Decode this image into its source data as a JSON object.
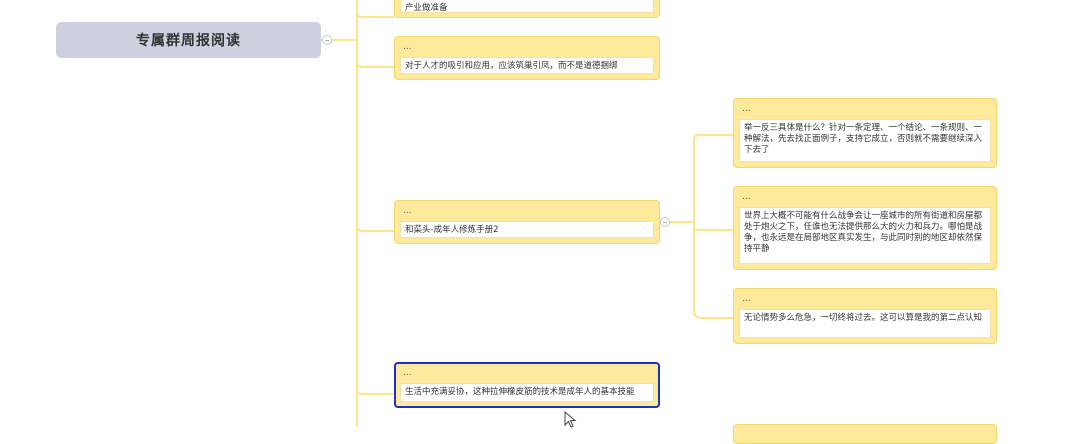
{
  "mindmap": {
    "root": {
      "label": "专属群周报阅读"
    },
    "nodes": [
      {
        "title": "",
        "text": "产业做准备"
      },
      {
        "title": "...",
        "text": "对于人才的吸引和应用，应该筑巢引凤，而不是道德捆绑"
      },
      {
        "title": "...",
        "text": "和菜头-成年人修炼手册2",
        "children": [
          {
            "title": "...",
            "text": "举一反三具体是什么？针对一条定理、一个结论、一条规则、一种解法，先去找正面例子，支持它成立，否则就不需要继续深入下去了"
          },
          {
            "title": "...",
            "text": "世界上大概不可能有什么战争会让一座城市的所有街道和房屋都处于炮火之下，任谁也无法提供那么大的火力和兵力。哪怕是战争，也永远是在局部地区真实发生，与此同时别的地区却依然保持平静"
          },
          {
            "title": "...",
            "text": "无论情势多么危急，一切终将过去。这可以算是我的第二点认知"
          }
        ]
      },
      {
        "title": "...",
        "text": "生活中充满妥协，这种拉伸橡皮筋的技术是成年人的基本技能",
        "selected": true
      }
    ]
  },
  "colors": {
    "connector": "#ffe58a",
    "card_fill": "#ffe99a",
    "card_border": "#f3d66d",
    "root_fill": "#cdd0de",
    "selection": "#1a2fd0"
  },
  "icons": {
    "collapse": "circle-minus-icon",
    "cursor": "mouse-pointer-icon"
  }
}
